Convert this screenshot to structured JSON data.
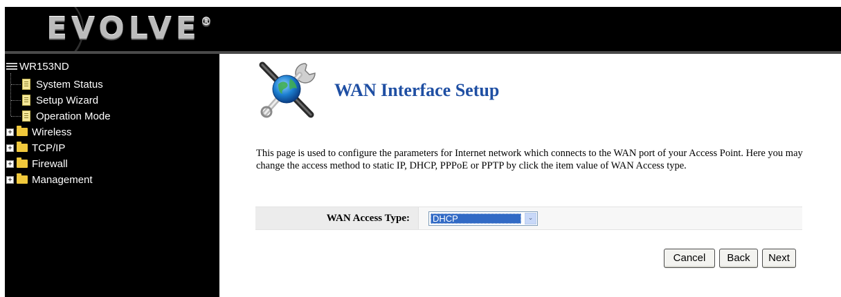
{
  "header": {
    "logo_text": "EVOLVE",
    "logo_mark": "®"
  },
  "sidebar": {
    "root_label": "WR153ND",
    "pages": [
      {
        "label": "System Status"
      },
      {
        "label": "Setup Wizard"
      },
      {
        "label": "Operation Mode"
      }
    ],
    "folders": [
      {
        "label": "Wireless"
      },
      {
        "label": "TCP/IP"
      },
      {
        "label": "Firewall"
      },
      {
        "label": "Management"
      }
    ]
  },
  "main": {
    "title": "WAN Interface Setup",
    "description": "This page is used to configure the parameters for Internet network which connects to the WAN port of your Access Point. Here you may change the access method to static IP, DHCP, PPPoE or PPTP by click the item value of WAN Access type.",
    "access_type": {
      "label": "WAN Access Type:",
      "selected": "DHCP"
    },
    "buttons": {
      "cancel": "Cancel",
      "back": "Back",
      "next": "Next"
    }
  },
  "colors": {
    "title": "#1f4fa3",
    "header_bg": "#000000",
    "select_highlight": "#316ac5"
  }
}
